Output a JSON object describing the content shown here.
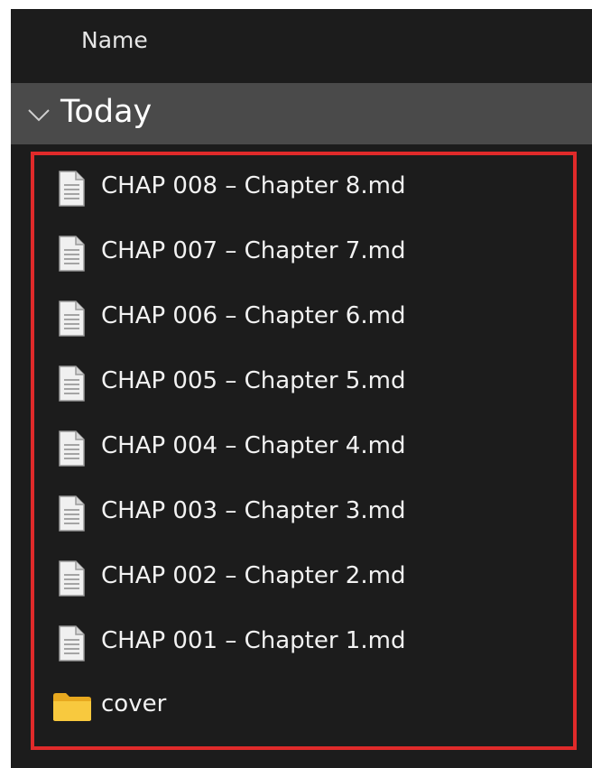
{
  "header": {
    "column_name": "Name"
  },
  "group": {
    "label": "Today",
    "icon": "chevron-down-icon"
  },
  "files": [
    {
      "label": "CHAP 008 – Chapter 8.md",
      "icon": "document-icon"
    },
    {
      "label": "CHAP 007 – Chapter 7.md",
      "icon": "document-icon"
    },
    {
      "label": "CHAP 006 – Chapter 6.md",
      "icon": "document-icon"
    },
    {
      "label": "CHAP 005 – Chapter 5.md",
      "icon": "document-icon"
    },
    {
      "label": "CHAP 004 – Chapter 4.md",
      "icon": "document-icon"
    },
    {
      "label": "CHAP 003 – Chapter 3.md",
      "icon": "document-icon"
    },
    {
      "label": "CHAP 002 – Chapter 2.md",
      "icon": "document-icon"
    },
    {
      "label": "CHAP 001 – Chapter 1.md",
      "icon": "document-icon"
    }
  ],
  "folders": [
    {
      "label": "cover",
      "icon": "folder-icon"
    }
  ],
  "colors": {
    "background": "#1c1c1c",
    "group_row": "#4a4a4a",
    "highlight_border": "#e02a2a",
    "folder": "#f5c33b",
    "text": "#f2f2f2"
  }
}
